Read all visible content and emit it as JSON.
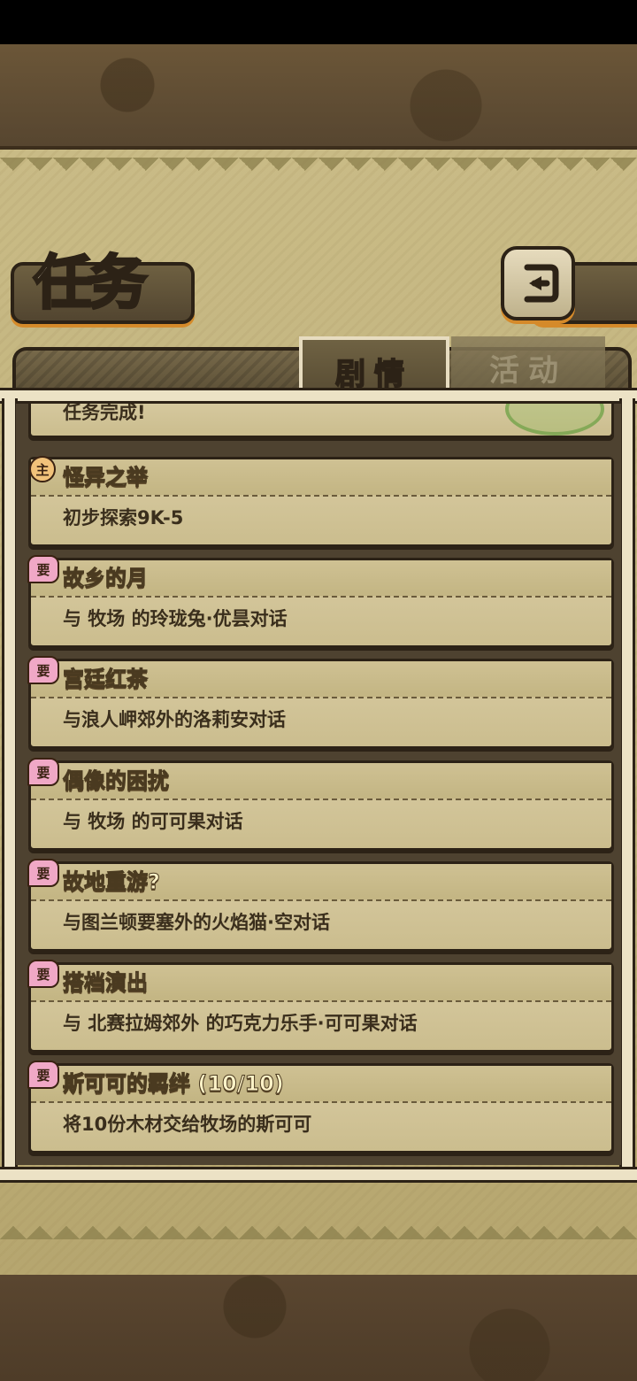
{
  "header": {
    "title": "任务",
    "back_icon": "back-arrow-icon"
  },
  "tabs": [
    {
      "label": "剧情",
      "active": true
    },
    {
      "label": "活动",
      "active": false
    }
  ],
  "completed_item": {
    "text": "任务完成!"
  },
  "quests": [
    {
      "badge": "主",
      "type": "main",
      "title": "怪异之举",
      "desc": "初步探索9K-5"
    },
    {
      "badge": "要",
      "type": "side",
      "title": "故乡的月",
      "desc": "与 牧场 的玲珑兔·优昙对话"
    },
    {
      "badge": "要",
      "type": "side",
      "title": "宫廷红茶",
      "desc": "与浪人岬郊外的洛莉安对话"
    },
    {
      "badge": "要",
      "type": "side",
      "title": "偶像的困扰",
      "desc": "与 牧场 的可可果对话"
    },
    {
      "badge": "要",
      "type": "side",
      "title": "故地重游?",
      "desc": "与图兰顿要塞外的火焰猫·空对话"
    },
    {
      "badge": "要",
      "type": "side",
      "title": "搭档演出",
      "desc": "与 北赛拉姆郊外 的巧克力乐手·可可果对话"
    },
    {
      "badge": "要",
      "type": "side",
      "title": "斯可可的羁绊 (10/10)",
      "desc": "将10份木材交给牧场的斯可可"
    }
  ],
  "colors": {
    "parchment": "#c9bb86",
    "card": "#d8cba2",
    "outline": "#2c2216",
    "accent": "#d58a2a"
  }
}
